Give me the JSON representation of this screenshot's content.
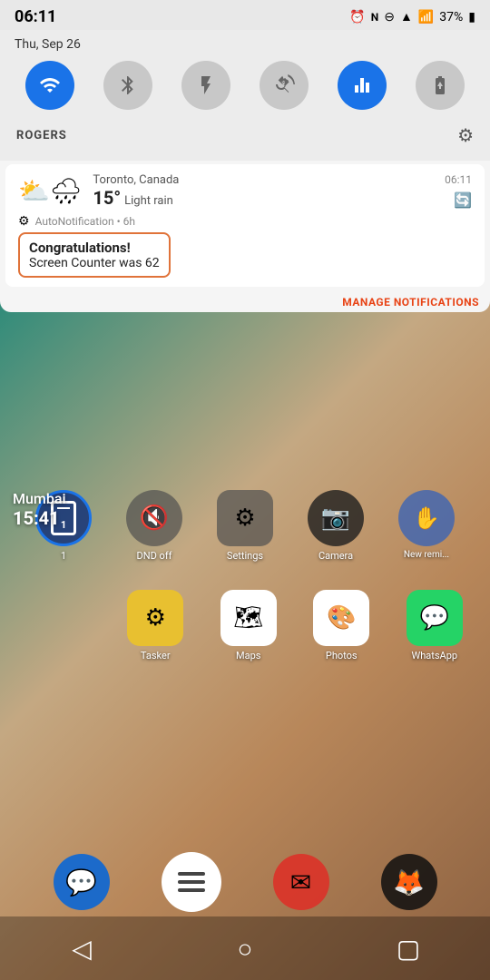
{
  "status_bar": {
    "time": "06:11",
    "battery": "37%",
    "battery_icon": "🔋"
  },
  "date_row": {
    "date": "Thu, Sep 26",
    "icons": [
      "⏰",
      "N",
      "⊖",
      "📶"
    ]
  },
  "toggles": [
    {
      "id": "wifi",
      "icon": "📶",
      "active": true,
      "label": "wifi-toggle"
    },
    {
      "id": "bluetooth",
      "icon": "bluetooth",
      "active": false,
      "label": "bluetooth-toggle"
    },
    {
      "id": "flashlight",
      "icon": "flashlight",
      "active": false,
      "label": "flashlight-toggle"
    },
    {
      "id": "screen_rotate",
      "icon": "rotate",
      "active": false,
      "label": "rotate-toggle"
    },
    {
      "id": "equalizer",
      "icon": "equalizer",
      "active": true,
      "label": "equalizer-toggle"
    },
    {
      "id": "battery_saver",
      "icon": "battery",
      "active": false,
      "label": "battery-toggle"
    }
  ],
  "carrier": {
    "name": "ROGERS",
    "settings_icon": "⚙"
  },
  "weather": {
    "location": "Toronto, Canada",
    "temperature": "15°",
    "description": "Light rain",
    "time": "06:11",
    "icon": "🌧"
  },
  "auto_notification": {
    "label": "AutoNotification • 6h",
    "icon": "⚙",
    "congrats_title": "Congratulations!",
    "congrats_body": "Screen Counter was 62"
  },
  "manage_notifications": {
    "label": "MANAGE NOTIFICATIONS"
  },
  "home_apps_row1": [
    {
      "name": "Screen",
      "label": "1",
      "bg": "rgba(30,60,120,0.85)",
      "border": "blue",
      "icon": "📱"
    },
    {
      "name": "DND off",
      "label": "DND off",
      "bg": "rgba(0,0,0,0.5)",
      "icon": "🔇"
    },
    {
      "name": "Settings",
      "label": "Settings",
      "bg": "rgba(0,0,0,0.5)",
      "icon": "⚙"
    },
    {
      "name": "Camera",
      "label": "Camera",
      "bg": "rgba(0,0,0,0.5)",
      "icon": "📷"
    },
    {
      "name": "New reminder",
      "label": "New remi...",
      "bg": "rgba(0,0,0,0.5)",
      "icon": "✋"
    }
  ],
  "home_apps_row2": [
    {
      "name": "Tasker",
      "label": "Tasker",
      "bg": "#f5c518",
      "icon": "⚙"
    },
    {
      "name": "Maps",
      "label": "Maps",
      "bg": "#4CAF50",
      "icon": "🗺"
    },
    {
      "name": "Photos",
      "label": "Photos",
      "bg": "white",
      "icon": "🎨"
    },
    {
      "name": "WhatsApp",
      "label": "WhatsApp",
      "bg": "#25D366",
      "icon": "💬"
    }
  ],
  "clock_widget": {
    "city": "Mumbai",
    "time": "15:41"
  },
  "dock": [
    {
      "name": "Messenger",
      "icon": "💬",
      "bg": "rgba(0,100,200,0.8)"
    },
    {
      "name": "Home",
      "icon": "≡",
      "bg": "white",
      "is_center": true
    },
    {
      "name": "Gmail",
      "icon": "✉",
      "bg": "rgba(220,50,50,0.9)"
    },
    {
      "name": "Firefox",
      "icon": "🦊",
      "bg": "rgba(20,20,20,0.8)"
    }
  ],
  "nav": {
    "back": "◁",
    "home": "○",
    "recents": "▢"
  }
}
